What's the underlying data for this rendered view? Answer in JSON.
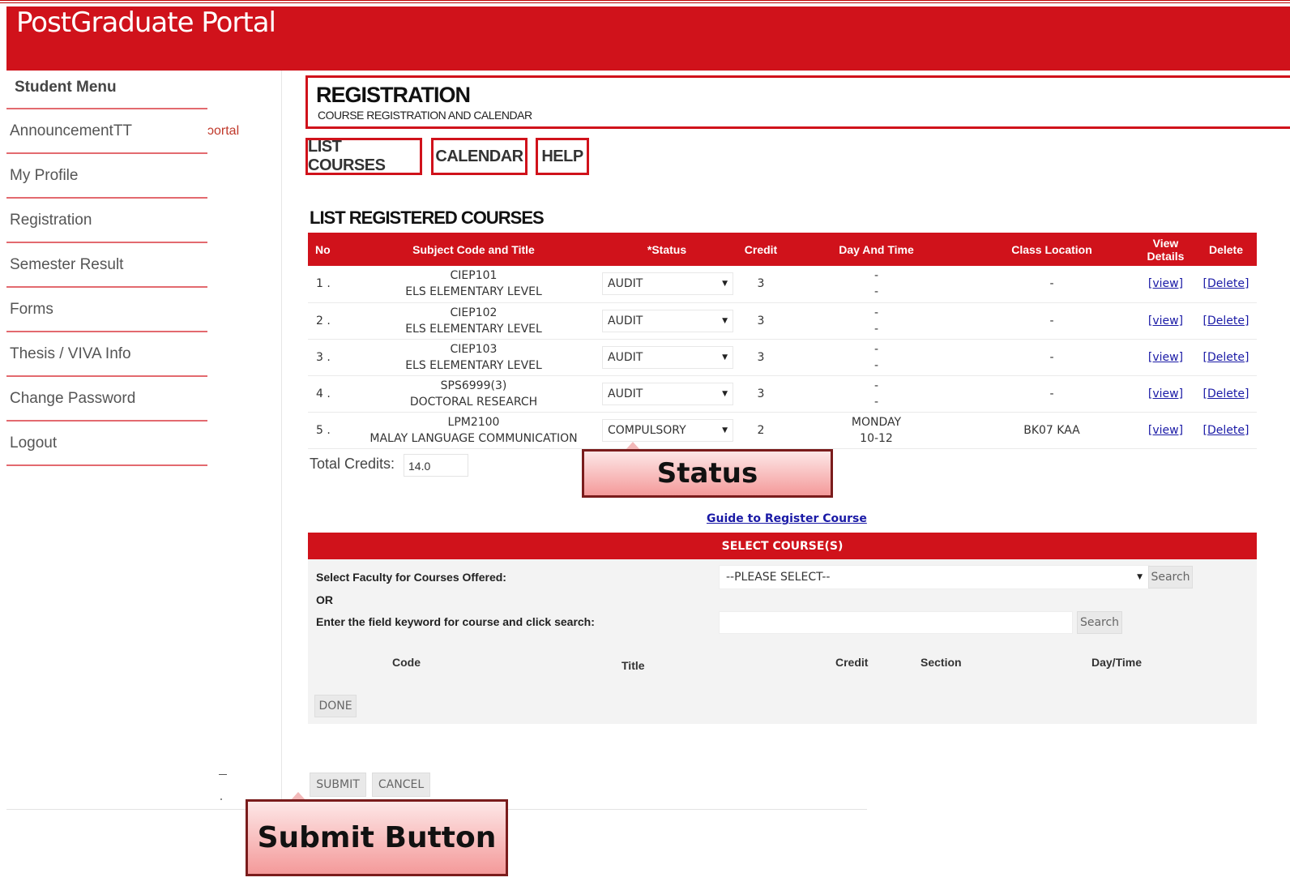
{
  "header": {
    "title": "PostGraduate Portal"
  },
  "sidebar": {
    "title": "Student Menu",
    "portal_fragment": "ɔortal",
    "items": [
      {
        "label": "AnnouncementTT"
      },
      {
        "label": "My Profile"
      },
      {
        "label": "Registration"
      },
      {
        "label": "Semester Result"
      },
      {
        "label": "Forms"
      },
      {
        "label": "Thesis / VIVA Info"
      },
      {
        "label": "Change Password"
      },
      {
        "label": "Logout"
      }
    ]
  },
  "registration": {
    "title": "REGISTRATION",
    "subtitle": "COURSE REGISTRATION AND CALENDAR",
    "tabs": [
      "LIST COURSES",
      "CALENDAR",
      "HELP"
    ]
  },
  "registered": {
    "heading": "LIST REGISTERED COURSES",
    "columns": [
      "No",
      "Subject Code and Title",
      "*Status",
      "Credit",
      "Day And Time",
      "Class Location",
      "View Details",
      "Delete"
    ],
    "rows": [
      {
        "no": "1 .",
        "code": "CIEP101",
        "title": "ELS ELEMENTARY LEVEL",
        "status": "AUDIT",
        "credit": "3",
        "day": "-",
        "time": "-",
        "location": "-",
        "view": "[view]",
        "delete": "[Delete]"
      },
      {
        "no": "2 .",
        "code": "CIEP102",
        "title": "ELS ELEMENTARY LEVEL",
        "status": "AUDIT",
        "credit": "3",
        "day": "-",
        "time": "-",
        "location": "-",
        "view": "[view]",
        "delete": "[Delete]"
      },
      {
        "no": "3 .",
        "code": "CIEP103",
        "title": "ELS ELEMENTARY LEVEL",
        "status": "AUDIT",
        "credit": "3",
        "day": "-",
        "time": "-",
        "location": "-",
        "view": "[view]",
        "delete": "[Delete]"
      },
      {
        "no": "4 .",
        "code": "SPS6999(3)",
        "title": "DOCTORAL RESEARCH",
        "status": "AUDIT",
        "credit": "3",
        "day": "-",
        "time": "-",
        "location": "-",
        "view": "[view]",
        "delete": "[Delete]"
      },
      {
        "no": "5 .",
        "code": "LPM2100",
        "title": "MALAY LANGUAGE COMMUNICATION",
        "status": "COMPULSORY",
        "credit": "2",
        "day": "MONDAY",
        "time": "10-12",
        "location": "BK07 KAA",
        "view": "[view]",
        "delete": "[Delete]"
      }
    ],
    "total_label": "Total Credits:",
    "total_value": "14.0"
  },
  "callouts": {
    "status": "Status",
    "submit": "Submit Button"
  },
  "guide_link": "Guide to Register Course",
  "select_courses": {
    "header": "SELECT COURSE(S)",
    "faculty_label": "Select Faculty for Courses Offered:",
    "faculty_value": "--PLEASE SELECT--",
    "search_label": "Search",
    "or_label": "OR",
    "keyword_label": "Enter the field keyword for course and click search:",
    "keyword_value": "",
    "columns": [
      "Code",
      "Title",
      "Credit",
      "Section",
      "Day/Time"
    ],
    "done_label": "DONE"
  },
  "actions": {
    "submit": "SUBMIT",
    "cancel": "CANCEL"
  },
  "colors": {
    "brand_red": "#d0121b",
    "link_blue": "#1a1aa6"
  }
}
